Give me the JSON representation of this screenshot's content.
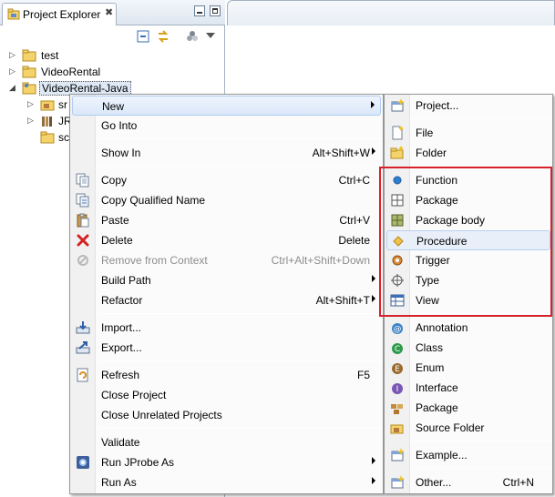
{
  "explorer": {
    "title": "Project Explorer",
    "close_glyph": "✖",
    "tree": [
      {
        "label": "test"
      },
      {
        "label": "VideoRental"
      },
      {
        "label": "VideoRental-Java"
      },
      {
        "label": "sr"
      },
      {
        "label": "JR"
      },
      {
        "label": "sc"
      }
    ]
  },
  "context_menu": {
    "items": [
      {
        "label": "New",
        "accel": "",
        "submenu": true,
        "icon": "none"
      },
      {
        "label": "Go Into",
        "accel": "",
        "icon": "none"
      },
      {
        "label": "Show In",
        "accel": "Alt+Shift+W",
        "submenu": true,
        "icon": "none"
      },
      {
        "label": "Copy",
        "accel": "Ctrl+C",
        "icon": "copy-icon"
      },
      {
        "label": "Copy Qualified Name",
        "accel": "",
        "icon": "copy-qualified-name-icon"
      },
      {
        "label": "Paste",
        "accel": "Ctrl+V",
        "icon": "paste-icon"
      },
      {
        "label": "Delete",
        "accel": "Delete",
        "icon": "delete-icon"
      },
      {
        "label": "Remove from Context",
        "accel": "Ctrl+Alt+Shift+Down",
        "icon": "remove-from-context-icon",
        "disabled": true
      },
      {
        "label": "Build Path",
        "accel": "",
        "submenu": true,
        "icon": "none"
      },
      {
        "label": "Refactor",
        "accel": "Alt+Shift+T",
        "submenu": true,
        "icon": "none"
      },
      {
        "label": "Import...",
        "accel": "",
        "icon": "import-icon"
      },
      {
        "label": "Export...",
        "accel": "",
        "icon": "export-icon"
      },
      {
        "label": "Refresh",
        "accel": "F5",
        "icon": "refresh-icon"
      },
      {
        "label": "Close Project",
        "accel": "",
        "icon": "none"
      },
      {
        "label": "Close Unrelated Projects",
        "accel": "",
        "icon": "none"
      },
      {
        "label": "Validate",
        "accel": "",
        "icon": "none"
      },
      {
        "label": "Run JProbe As",
        "accel": "",
        "submenu": true,
        "icon": "jprobe-icon"
      },
      {
        "label": "Run As",
        "accel": "",
        "submenu": true,
        "icon": "none"
      }
    ]
  },
  "new_submenu": {
    "items": [
      {
        "label": "Project...",
        "accel": "",
        "icon": "new-project-icon"
      },
      {
        "label": "File",
        "accel": "",
        "icon": "new-file-icon"
      },
      {
        "label": "Folder",
        "accel": "",
        "icon": "new-folder-icon"
      },
      {
        "label": "Function",
        "accel": "",
        "icon": "function-icon"
      },
      {
        "label": "Package",
        "accel": "",
        "icon": "db-package-icon"
      },
      {
        "label": "Package body",
        "accel": "",
        "icon": "package-body-icon"
      },
      {
        "label": "Procedure",
        "accel": "",
        "icon": "procedure-icon"
      },
      {
        "label": "Trigger",
        "accel": "",
        "icon": "trigger-icon"
      },
      {
        "label": "Type",
        "accel": "",
        "icon": "type-icon"
      },
      {
        "label": "View",
        "accel": "",
        "icon": "view-icon"
      },
      {
        "label": "Annotation",
        "accel": "",
        "icon": "annotation-icon"
      },
      {
        "label": "Class",
        "accel": "",
        "icon": "class-icon"
      },
      {
        "label": "Enum",
        "accel": "",
        "icon": "enum-icon"
      },
      {
        "label": "Interface",
        "accel": "",
        "icon": "interface-icon"
      },
      {
        "label": "Package",
        "accel": "",
        "icon": "java-package-icon"
      },
      {
        "label": "Source Folder",
        "accel": "",
        "icon": "source-folder-icon"
      },
      {
        "label": "Example...",
        "accel": "",
        "icon": "example-icon"
      },
      {
        "label": "Other...",
        "accel": "Ctrl+N",
        "icon": "other-icon"
      }
    ]
  },
  "colors": {
    "highlight_box": "#d6212b",
    "menu_highlight": "#dbe8fa",
    "function_dot": "#2f7fd1",
    "procedure_diamond": "#f2c24f"
  }
}
